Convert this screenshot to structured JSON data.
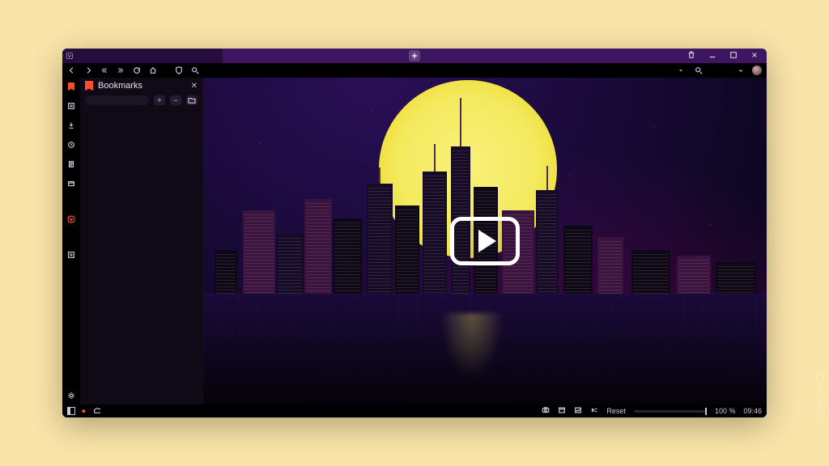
{
  "window": {
    "watermark": "VIVALDI"
  },
  "panel": {
    "title": "Bookmarks",
    "add_label": "+",
    "remove_label": "−",
    "folder_label": "⌂"
  },
  "statusbar": {
    "reset_label": "Reset",
    "zoom_value": "100 %",
    "clock": "09:46"
  },
  "rail": {
    "items": [
      {
        "name": "bookmarks",
        "active": true
      },
      {
        "name": "reading-list"
      },
      {
        "name": "downloads"
      },
      {
        "name": "history"
      },
      {
        "name": "notes"
      },
      {
        "name": "window-panel"
      },
      {
        "name": "divider"
      },
      {
        "name": "vivaldi-social"
      },
      {
        "name": "divider"
      },
      {
        "name": "add-web-panel"
      }
    ]
  },
  "titlebar_controls": {
    "trash": "trash",
    "minimize": "min",
    "maximize": "max",
    "close": "close"
  }
}
